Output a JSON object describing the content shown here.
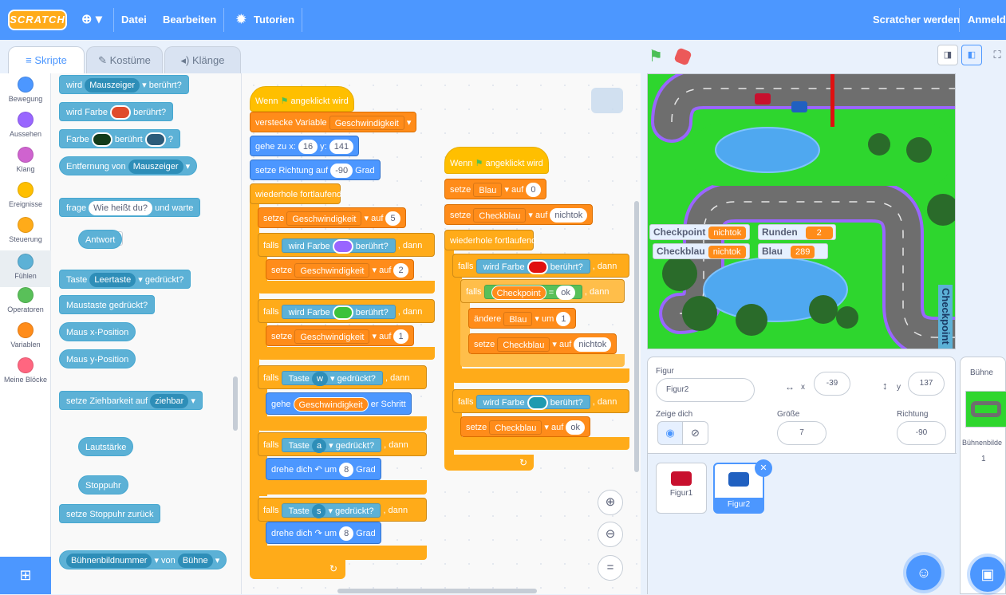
{
  "menubar": {
    "logo": "SCRATCH",
    "language_icon": "globe-icon",
    "file": "Datei",
    "edit": "Bearbeiten",
    "tutorials": "Tutorien",
    "join": "Scratcher werden",
    "signin": "Anmelde"
  },
  "tabs": {
    "code": "Skripte",
    "costumes": "Kostüme",
    "sounds": "Klänge"
  },
  "categories": [
    {
      "label": "Bewegung",
      "color": "#4c97ff"
    },
    {
      "label": "Aussehen",
      "color": "#9966ff"
    },
    {
      "label": "Klang",
      "color": "#cf63cf"
    },
    {
      "label": "Ereignisse",
      "color": "#ffbf00"
    },
    {
      "label": "Steuerung",
      "color": "#ffab19"
    },
    {
      "label": "Fühlen",
      "color": "#5cb1d6"
    },
    {
      "label": "Operatoren",
      "color": "#59c059"
    },
    {
      "label": "Variablen",
      "color": "#ff8c1a"
    },
    {
      "label": "Meine Blöcke",
      "color": "#ff6680"
    }
  ],
  "palette": {
    "touching_pre": "wird",
    "touching_dd": "Mauszeiger",
    "touching_post": "berührt?",
    "touch_color_pre": "wird Farbe",
    "touch_color_post": "berührt?",
    "color_touch_pre": "Farbe",
    "color_touch_mid": "berührt",
    "color_touch_post": "?",
    "distance_pre": "Entfernung von",
    "distance_dd": "Mauszeiger",
    "ask_pre": "frage",
    "ask_val": "Wie heißt du?",
    "ask_post": "und warte",
    "answer": "Antwort",
    "key_pre": "Taste",
    "key_dd": "Leertaste",
    "key_post": "gedrückt?",
    "mouse_down": "Maustaste gedrückt?",
    "mouse_x": "Maus x-Position",
    "mouse_y": "Maus y-Position",
    "drag_pre": "setze Ziehbarkeit auf",
    "drag_dd": "ziehbar",
    "loudness": "Lautstärke",
    "timer": "Stoppuhr",
    "reset_timer": "setze Stoppuhr zurück",
    "of_dd1": "Bühnenbildnummer",
    "of_mid": "von",
    "of_dd2": "Bühne"
  },
  "script1": {
    "hat": "Wenn",
    "hat_post": "angeklickt wird",
    "hide_var": "verstecke Variable",
    "hide_var_dd": "Geschwindigkeit",
    "goto_pre": "gehe zu x:",
    "goto_x": "16",
    "goto_y_lbl": "y:",
    "goto_y": "141",
    "dir_pre": "setze Richtung auf",
    "dir_val": "-90",
    "dir_post": "Grad",
    "forever": "wiederhole fortlaufend",
    "set": "setze",
    "set_dd": "Geschwindigkeit",
    "to": "auf",
    "set_val": "5",
    "if": "falls",
    "then": ", dann",
    "touch_color": "wird Farbe",
    "touched": "berührt?",
    "set2_val": "2",
    "set3_val": "1",
    "key": "Taste",
    "key_w": "w",
    "key_a": "a",
    "key_s": "s",
    "pressed": "gedrückt?",
    "move_pre": "gehe",
    "move_var": "Geschwindigkeit",
    "move_post": "er Schritt",
    "turn": "drehe dich",
    "by": "um",
    "turn_val": "8",
    "deg": "Grad"
  },
  "script2": {
    "hat": "Wenn",
    "hat_post": "angeklickt wird",
    "set": "setze",
    "to": "auf",
    "blau_dd": "Blau",
    "blau_val": "0",
    "checkblau_dd": "Checkblau",
    "checkblau_val": "nichtok",
    "forever": "wiederhole fortlaufend",
    "if": "falls",
    "then": ", dann",
    "touch_color": "wird Farbe",
    "touched": "berührt?",
    "checkpoint_var": "Checkpoint",
    "equals": "=",
    "eq_val": "ok",
    "change": "ändere",
    "change_dd": "Blau",
    "by": "um",
    "change_val": "1",
    "set_cb_val": "nichtok",
    "set_cb_val2": "ok"
  },
  "stage": {
    "monitors": [
      {
        "label": "Checkpoint",
        "value": "nichtok"
      },
      {
        "label": "Runden",
        "value": "2"
      },
      {
        "label": "Checkblau",
        "value": "nichtok"
      },
      {
        "label": "Blau",
        "value": "289"
      }
    ],
    "checkpoint_text": "Checkpoint"
  },
  "sprite_info": {
    "sprite_label": "Figur",
    "sprite_name": "Figur2",
    "x_label": "x",
    "x": "-39",
    "y_label": "y",
    "y": "137",
    "show_label": "Zeige dich",
    "size_label": "Größe",
    "size": "7",
    "direction_label": "Richtung",
    "direction": "-90"
  },
  "sprites": [
    {
      "name": "Figur1"
    },
    {
      "name": "Figur2"
    }
  ],
  "stage_pane": {
    "title": "Bühne",
    "backdrops_label": "Bühnenbilde",
    "backdrops_count": "1"
  }
}
